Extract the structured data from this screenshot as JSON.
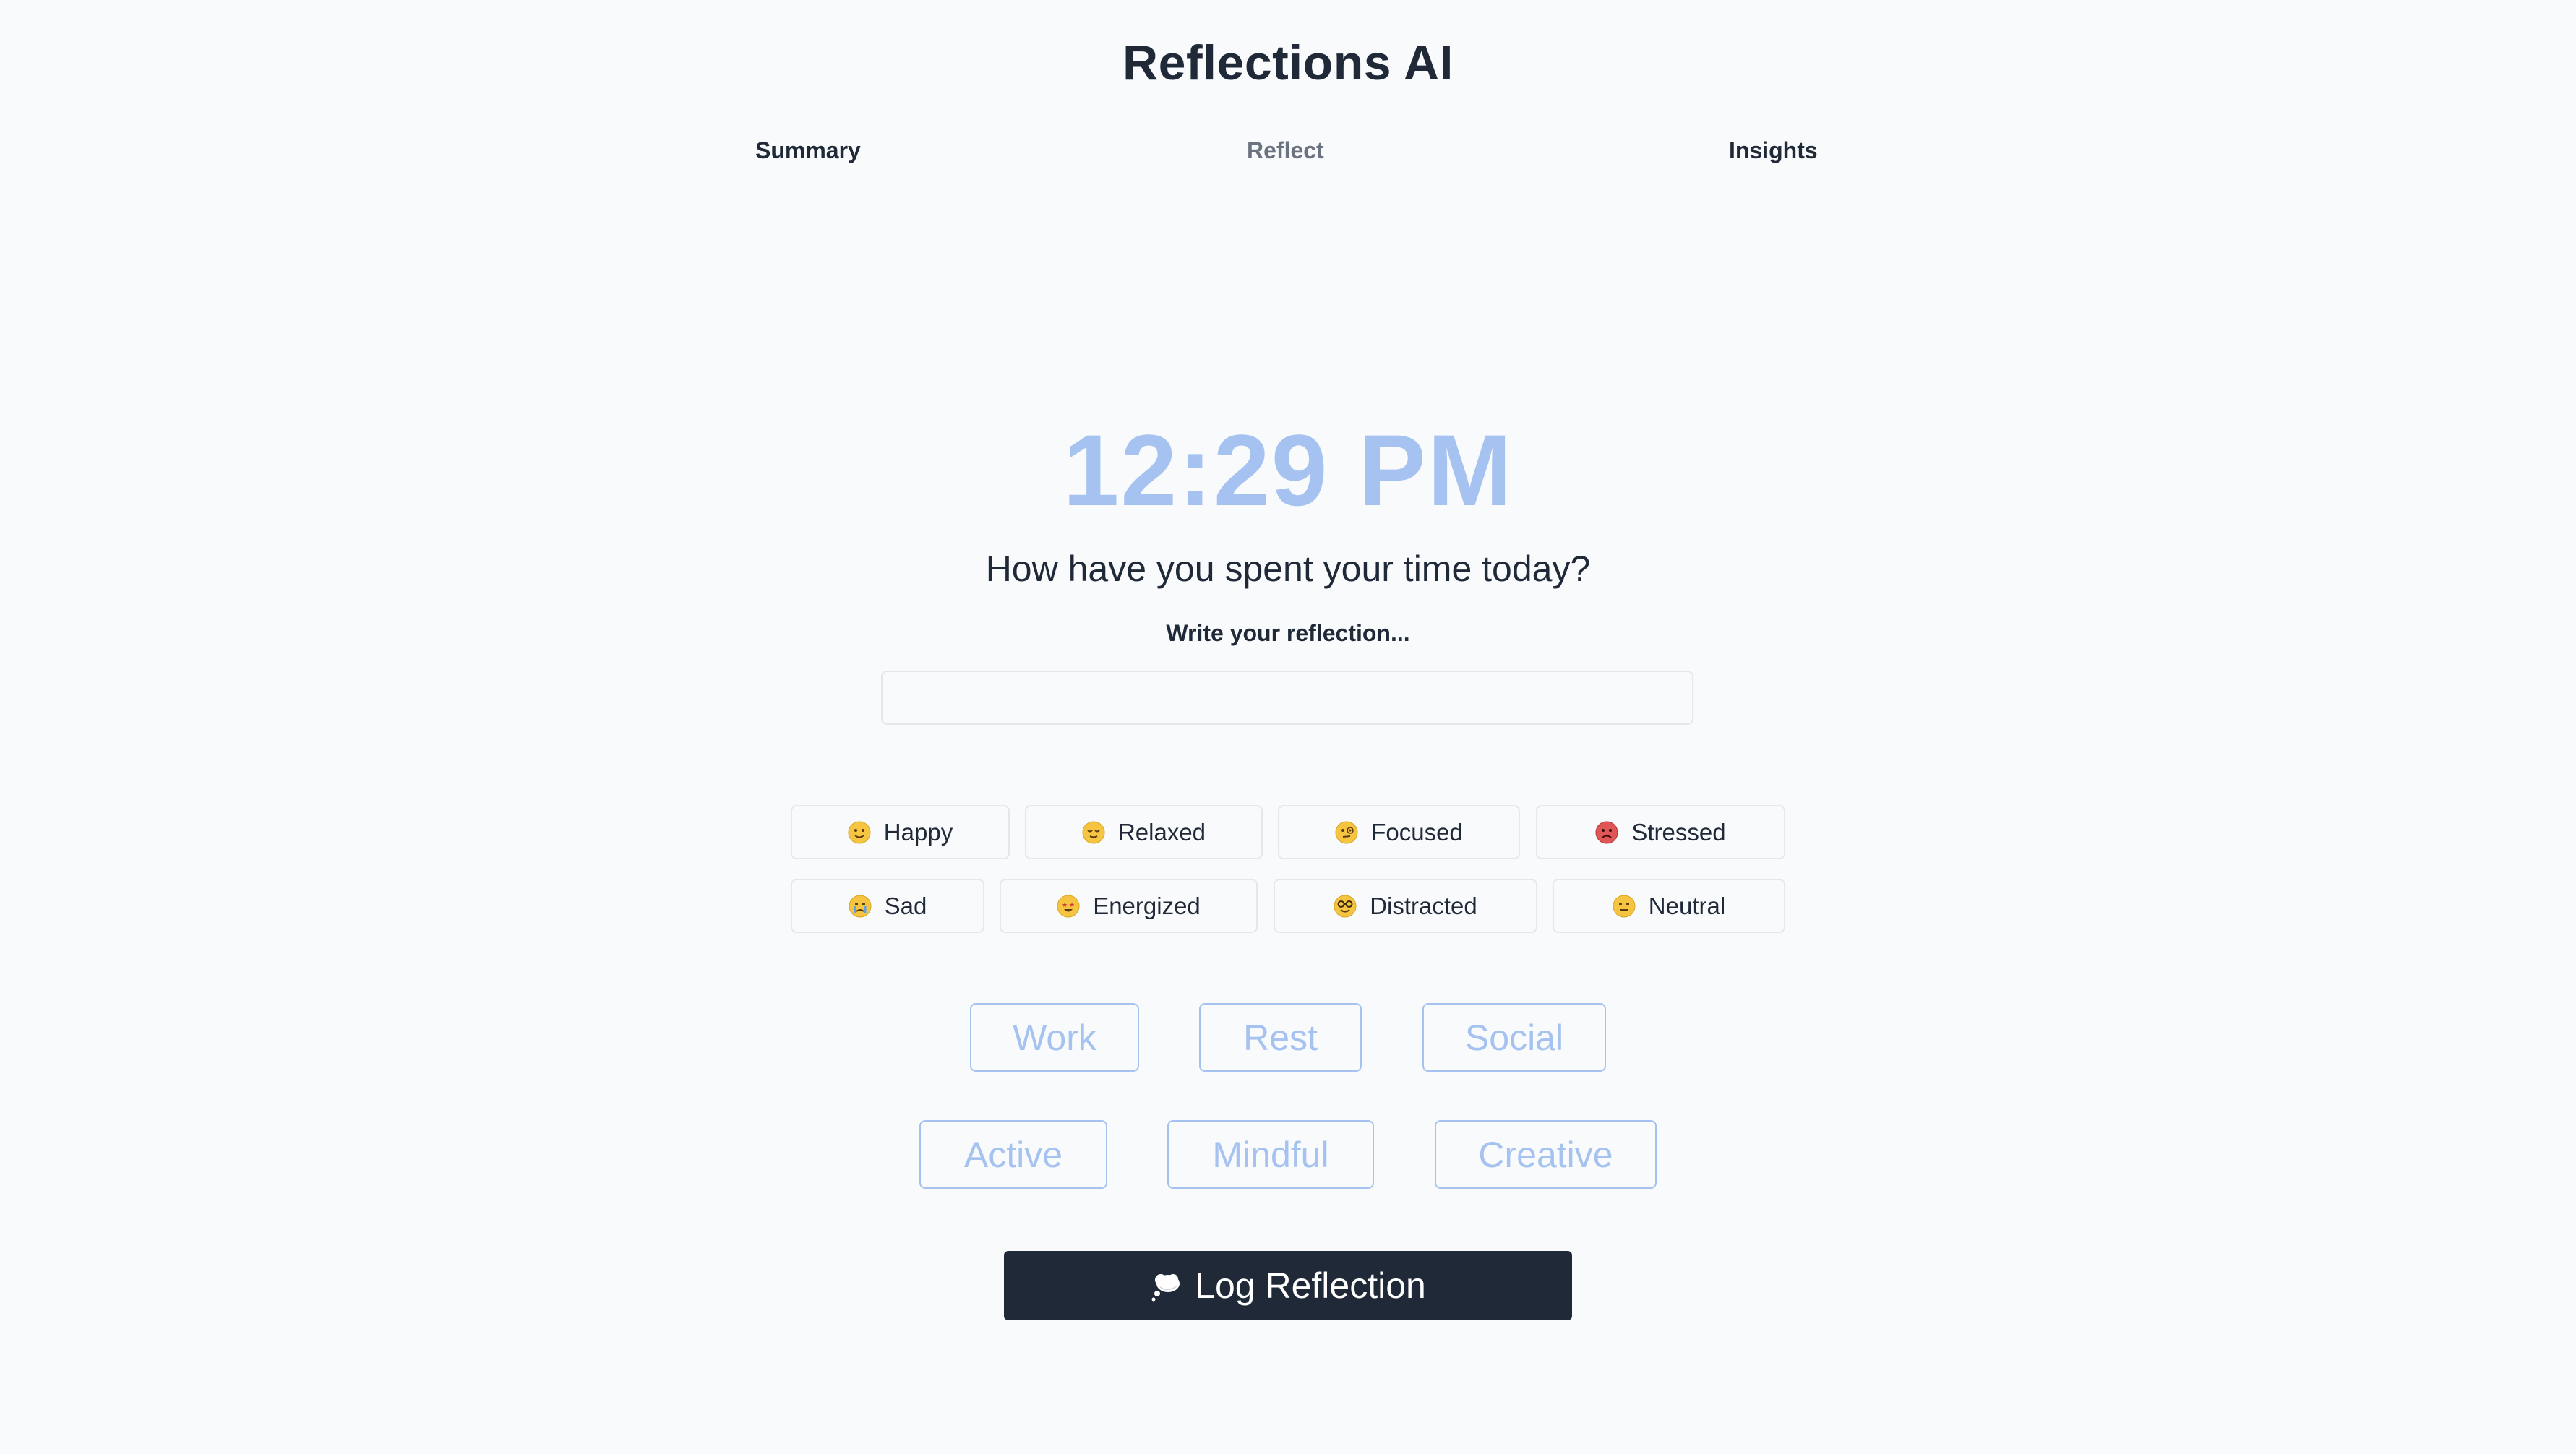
{
  "app": {
    "title": "Reflections AI"
  },
  "nav": {
    "tabs": [
      {
        "label": "Summary",
        "active": false
      },
      {
        "label": "Reflect",
        "active": true
      },
      {
        "label": "Insights",
        "active": false
      }
    ]
  },
  "clock": {
    "time": "12:29 PM"
  },
  "prompt": {
    "question": "How have you spent your time today?",
    "input_label": "Write your reflection...",
    "input_value": "",
    "input_placeholder": ""
  },
  "moods": [
    {
      "label": "Happy",
      "icon": "slightly-smiling-face-icon",
      "color": "#f5c542"
    },
    {
      "label": "Relaxed",
      "icon": "relieved-face-icon",
      "color": "#f5c542"
    },
    {
      "label": "Focused",
      "icon": "monocle-face-icon",
      "color": "#f5c542"
    },
    {
      "label": "Stressed",
      "icon": "flushed-red-face-icon",
      "color": "#e05656"
    },
    {
      "label": "Sad",
      "icon": "crying-face-icon",
      "color": "#f5c542"
    },
    {
      "label": "Energized",
      "icon": "star-struck-face-icon",
      "color": "#f5c542"
    },
    {
      "label": "Distracted",
      "icon": "nerd-face-icon",
      "color": "#f5c542"
    },
    {
      "label": "Neutral",
      "icon": "neutral-face-icon",
      "color": "#f5c542"
    }
  ],
  "activities": [
    {
      "label": "Work"
    },
    {
      "label": "Rest"
    },
    {
      "label": "Social"
    },
    {
      "label": "Active"
    },
    {
      "label": "Mindful"
    },
    {
      "label": "Creative"
    }
  ],
  "log_button": {
    "label": "Log Reflection",
    "icon": "thought-bubble-icon"
  },
  "colors": {
    "background": "#f8fafc",
    "text": "#1f2937",
    "accent_light": "#a5c2f0",
    "button_dark": "#1f2937"
  }
}
